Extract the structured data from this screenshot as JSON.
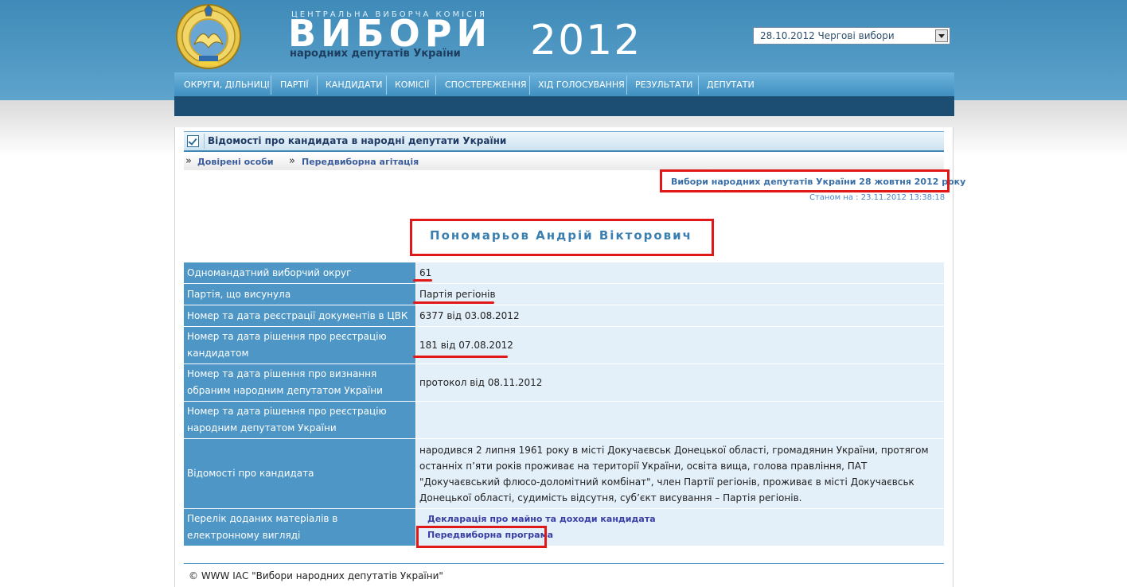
{
  "header": {
    "small_title": "ЦЕНТРАЛЬНА ВИБОРЧА КОМІСІЯ",
    "big_title": "ВИБОРИ",
    "subtitle": "народних депутатів України",
    "year": "2012",
    "election_select": {
      "selected": "28.10.2012 Чергові вибори"
    }
  },
  "nav": {
    "items": [
      {
        "label": "ОКРУГИ, ДІЛЬНИЦІ"
      },
      {
        "label": "ПАРТІЇ"
      },
      {
        "label": "КАНДИДАТИ"
      },
      {
        "label": "КОМІСІЇ"
      },
      {
        "label": "СПОСТЕРЕЖЕННЯ"
      },
      {
        "label": "ХІД ГОЛОСУВАННЯ"
      },
      {
        "label": "РЕЗУЛЬТАТИ"
      },
      {
        "label": "ДЕПУТАТИ"
      }
    ]
  },
  "page": {
    "title": "Відомості про кандидата в народні депутати України",
    "sublinks": [
      {
        "label": "Довірені особи"
      },
      {
        "label": "Передвиборна агітація"
      }
    ],
    "election_link": "Вибори народних депутатів України 28 жовтня 2012 року",
    "timestamp": "Станом на : 23.11.2012 13:38:18",
    "candidate_name": "Пономарьов Андрій Вікторович"
  },
  "table": {
    "rows": [
      {
        "label": "Одномандатний виборчий округ",
        "value": "61"
      },
      {
        "label": "Партія, що висунула",
        "value": "Партія регіонів"
      },
      {
        "label": "Номер та дата реєстрації документів в ЦВК",
        "value": "6377 від 03.08.2012"
      },
      {
        "label": "Номер та дата рішення про реєстрацію кандидатом",
        "value": "181 від 07.08.2012"
      },
      {
        "label": "Номер та дата рішення про визнання обраним народним депутатом України",
        "value": "протокол від 08.11.2012"
      },
      {
        "label": "Номер та дата рішення про реєстрацію народним депутатом України",
        "value": ""
      },
      {
        "label": "Відомості про кандидата",
        "value": "народився 2 липня 1961 року в місті Докучаєвськ Донецької області, громадянин України, протягом останніх п’яти років проживає на території України, освіта вища, голова правління, ПАТ \"Докучаєвський флюсо-доломітний комбінат\", член Партії регіонів, проживає в місті Докучаєвськ Донецької області, судимість відсутня, суб’єкт висування – Партія регіонів."
      },
      {
        "label": "Перелік доданих матеріалів в електронному вигляді",
        "links": [
          "Декларація про майно та доходи кандидата",
          "Передвиборна програма"
        ]
      }
    ]
  },
  "footer": {
    "text": "© WWW ІАС \"Вибори народних депутатів України\""
  },
  "colors": {
    "header_blue": "#4a93c2",
    "nav_dark": "#1c4d72",
    "label_cell": "#4d96c6",
    "value_cell": "#e3eff9",
    "highlight_red": "#e01818"
  }
}
